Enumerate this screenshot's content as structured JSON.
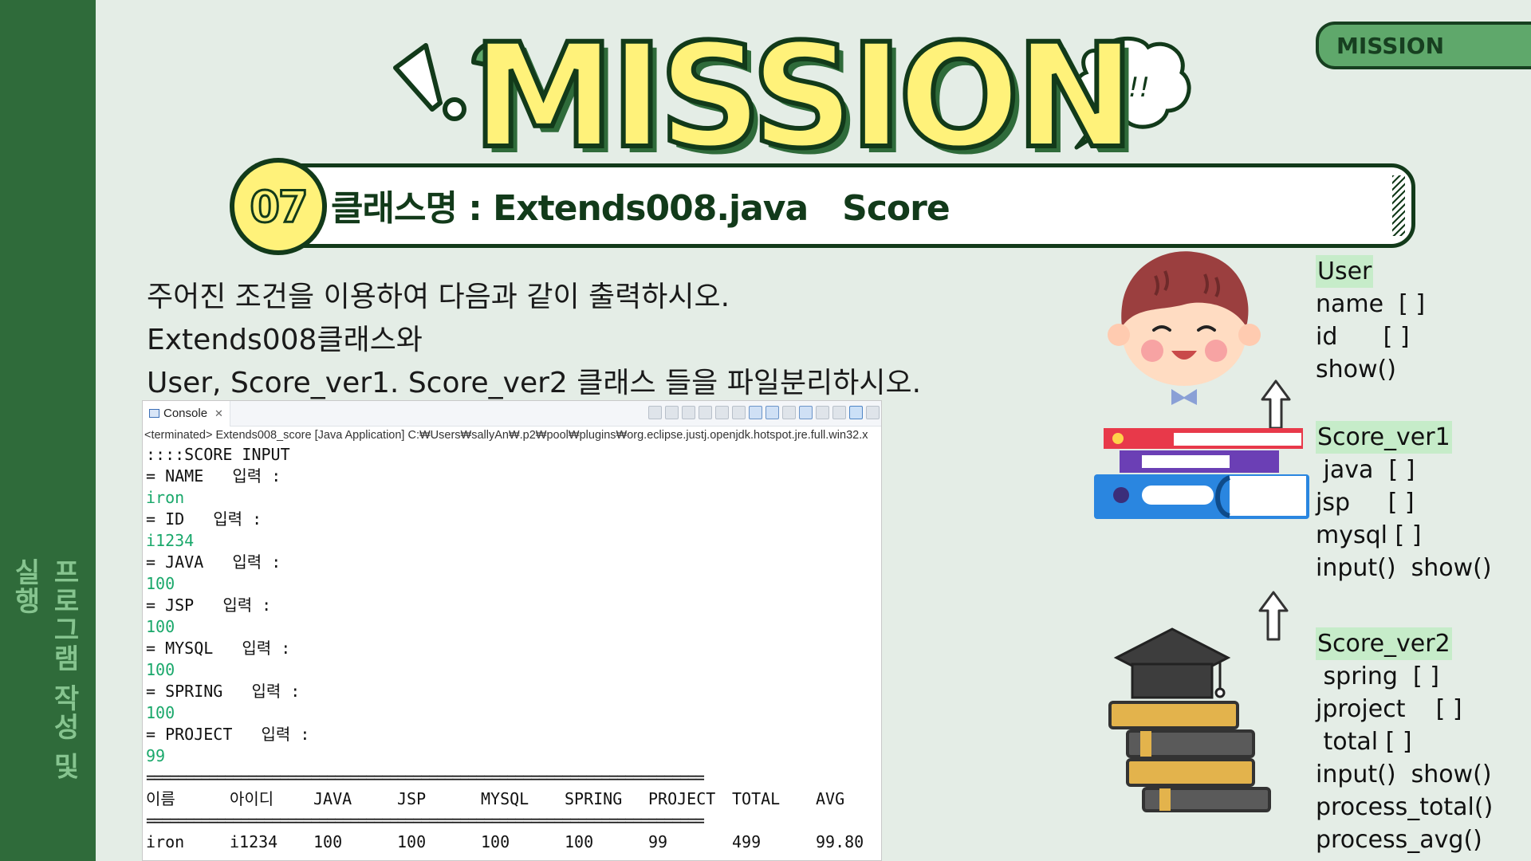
{
  "sidebar": {
    "vertical_label": "프로그램 작성 및 실행"
  },
  "tab": {
    "label": "MISSION"
  },
  "header": {
    "big_title": "MISSION",
    "bubble_text": "Q!!",
    "number": "07",
    "title": "클래스명 : Extends008.java   Score"
  },
  "instructions": [
    "주어진 조건을 이용하여 다음과 같이 출력하시오.",
    "Extends008클래스와",
    "User, Score_ver1. Score_ver2 클래스 들을 파일분리하시오."
  ],
  "console": {
    "tab_label": "Console",
    "status": "<terminated> Extends008_score [Java Application] C:₩Users₩sallyAn₩.p2₩pool₩plugins₩org.eclipse.justj.openjdk.hotspot.jre.full.win32.x",
    "lines": [
      {
        "text": "::::SCORE INPUT",
        "kind": "output"
      },
      {
        "text": "= NAME   입력 :",
        "kind": "output"
      },
      {
        "text": "iron",
        "kind": "input"
      },
      {
        "text": "= ID   입력 :",
        "kind": "output"
      },
      {
        "text": "i1234",
        "kind": "input"
      },
      {
        "text": "= JAVA   입력 :",
        "kind": "output"
      },
      {
        "text": "100",
        "kind": "input"
      },
      {
        "text": "= JSP   입력 :",
        "kind": "output"
      },
      {
        "text": "100",
        "kind": "input"
      },
      {
        "text": "= MYSQL   입력 :",
        "kind": "output"
      },
      {
        "text": "100",
        "kind": "input"
      },
      {
        "text": "= SPRING   입력 :",
        "kind": "output"
      },
      {
        "text": "100",
        "kind": "input"
      },
      {
        "text": "= PROJECT   입력 :",
        "kind": "output"
      },
      {
        "text": "99",
        "kind": "input"
      }
    ],
    "separator": "=======================================================================",
    "table_headers": [
      "이름",
      "아이디",
      "JAVA",
      "JSP",
      "MYSQL",
      "SPRING",
      "PROJECT",
      "TOTAL",
      "AVG"
    ],
    "table_row": [
      "iron",
      "i1234",
      "100",
      "100",
      "100",
      "100",
      "99",
      "499",
      "99.80"
    ]
  },
  "notes": {
    "user": {
      "title": "User",
      "lines": [
        "name  [ ]",
        "id      [ ]",
        "show()"
      ]
    },
    "score_ver1": {
      "title": "Score_ver1",
      "lines": [
        " java  [ ]",
        "jsp     [ ]",
        "mysql [ ]",
        "input()  show()"
      ]
    },
    "score_ver2": {
      "title": "Score_ver2",
      "lines": [
        " spring  [ ]",
        "jproject    [ ]",
        " total [ ]",
        "input()  show()",
        "process_total()",
        "process_avg()"
      ]
    }
  },
  "colors": {
    "stripe": "#2f6b3a",
    "background": "#e4ede6",
    "title_yellow": "#fff27a",
    "dark_green": "#123a1a",
    "input_text": "#1aa86b",
    "highlight": "#c6ecc9"
  },
  "icons": [
    "exclamation-icon",
    "question-mark-icon",
    "speech-bubble-icon",
    "boy-character-illustration",
    "books-stack-illustration",
    "graduation-books-illustration",
    "up-arrow-icon"
  ]
}
